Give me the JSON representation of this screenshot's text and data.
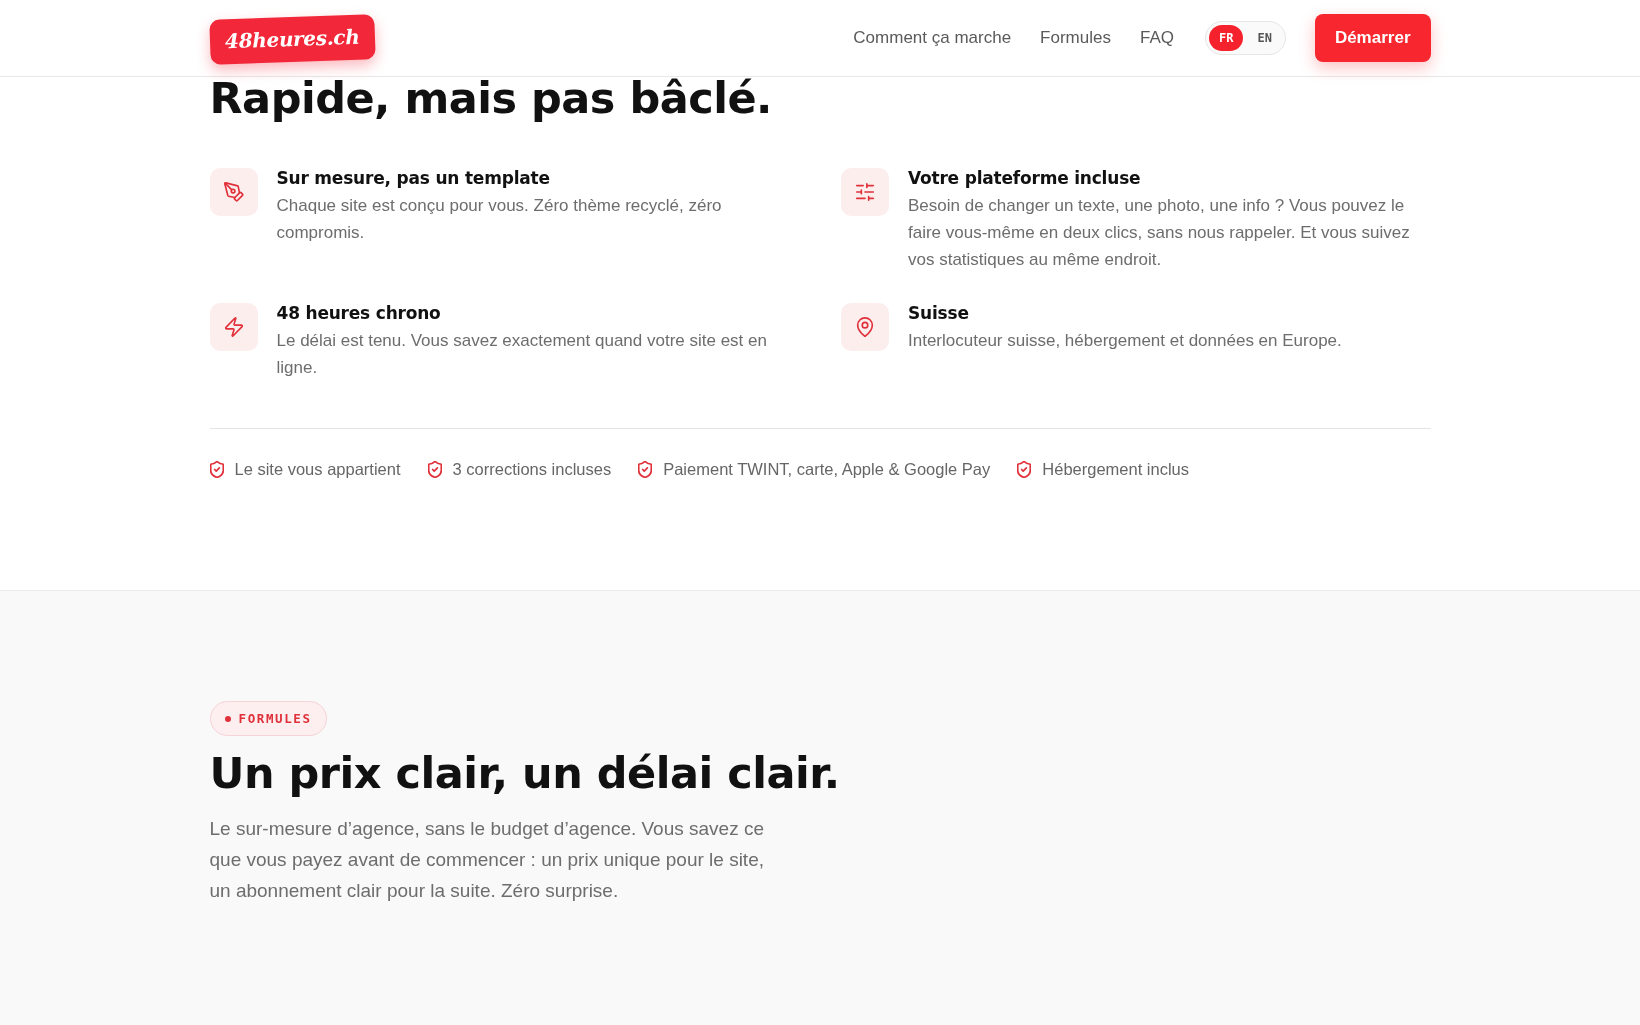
{
  "header": {
    "logo": "48heures.ch",
    "nav": [
      "Comment ça marche",
      "Formules",
      "FAQ"
    ],
    "languages": [
      {
        "label": "FR",
        "selected": true
      },
      {
        "label": "EN",
        "selected": false
      }
    ],
    "cta": "Démarrer"
  },
  "features_section": {
    "heading": "Rapide, mais pas bâclé.",
    "features": [
      {
        "title": "Sur mesure, pas un template",
        "description": "Chaque site est conçu pour vous. Zéro thème recyclé, zéro compromis."
      },
      {
        "title": "Votre plateforme incluse",
        "description": "Besoin de changer un texte, une photo, une info ? Vous pouvez le faire vous-même en deux clics, sans nous rappeler. Et vous suivez vos statistiques au même endroit."
      },
      {
        "title": "48 heures chrono",
        "description": "Le délai est tenu. Vous savez exactement quand votre site est en ligne."
      },
      {
        "title": "Suisse",
        "description": "Interlocuteur suisse, hébergement et données en Europe."
      }
    ],
    "guarantees": [
      "Le site vous appartient",
      "3 corrections incluses",
      "Paiement TWINT, carte, Apple & Google Pay",
      "Hébergement inclus"
    ]
  },
  "pricing_section": {
    "tag": "FORMULES",
    "heading": "Un prix clair, un délai clair.",
    "intro": "Le sur-mesure d’agence, sans le budget d’agence. Vous savez ce que vous payez avant de commencer : un prix unique pour le site, un abonnement clair pour la suite. Zéro surprise."
  }
}
